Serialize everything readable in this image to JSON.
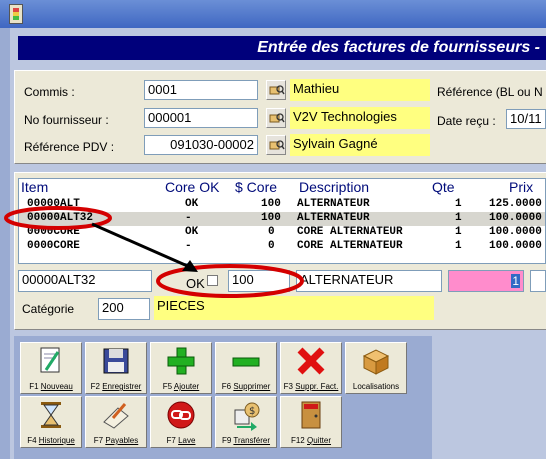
{
  "window": {
    "header_title": "Entrée des factures de fournisseurs -"
  },
  "form": {
    "commis": {
      "label": "Commis :",
      "value": "0001",
      "name": "Mathieu"
    },
    "fournisseur": {
      "label": "No fournisseur :",
      "value": "000001",
      "name": "V2V Technologies"
    },
    "ref_pdv": {
      "label": "Référence PDV :",
      "value": "091030-00002",
      "name": "Sylvain Gagné"
    },
    "reference": {
      "label": "Référence (BL ou N"
    },
    "date_recu": {
      "label": "Date reçu :",
      "value": "10/11"
    }
  },
  "grid": {
    "headers": [
      "Item",
      "Core OK",
      "$ Core",
      "Description",
      "Qte",
      "Prix"
    ],
    "rows": [
      [
        "00000ALT",
        "OK",
        "100",
        "ALTERNATEUR",
        "1",
        "125.0000"
      ],
      [
        "00000ALT32",
        "-",
        "100",
        "ALTERNATEUR",
        "1",
        "100.0000"
      ],
      [
        "0000CORE",
        "OK",
        "0",
        "CORE ALTERNATEUR",
        "1",
        "100.0000"
      ],
      [
        "0000CORE",
        "-",
        "0",
        "CORE ALTERNATEUR",
        "1",
        "100.0000"
      ]
    ]
  },
  "edit": {
    "item": "00000ALT32",
    "ok_label": "OK",
    "core": "100",
    "description": "ALTERNATEUR",
    "qte": "1"
  },
  "categorie": {
    "label": "Catégorie",
    "code": "200",
    "name": "PIECES"
  },
  "toolbar": [
    {
      "key": "F1",
      "label": "Nouveau",
      "icon": "document-pen-icon"
    },
    {
      "key": "F2",
      "label": "Enregistrer",
      "icon": "floppy-disk-icon"
    },
    {
      "key": "F5",
      "label": "Ajouter",
      "icon": "plus-icon"
    },
    {
      "key": "F6",
      "label": "Supprimer",
      "icon": "minus-icon"
    },
    {
      "key": "F3",
      "label": "Suppr. Fact.",
      "icon": "red-x-icon"
    },
    {
      "key": "",
      "label": "Localisations",
      "icon": "box-icon"
    },
    {
      "key": "F4",
      "label": "Historique",
      "icon": "hourglass-icon"
    },
    {
      "key": "F7",
      "label": "Payables",
      "icon": "pen-paper-icon"
    },
    {
      "key": "F7",
      "label": "Lave",
      "icon": "chain-link-icon"
    },
    {
      "key": "F9",
      "label": "Transférer",
      "icon": "transfer-icon"
    },
    {
      "key": "F12",
      "label": "Quitter",
      "icon": "exit-door-icon"
    }
  ],
  "colors": {
    "header_bg": "#00007b",
    "highlight_yellow": "#ffff80",
    "qte_pink": "#ff8ccc",
    "annotation_red": "#d40000"
  }
}
